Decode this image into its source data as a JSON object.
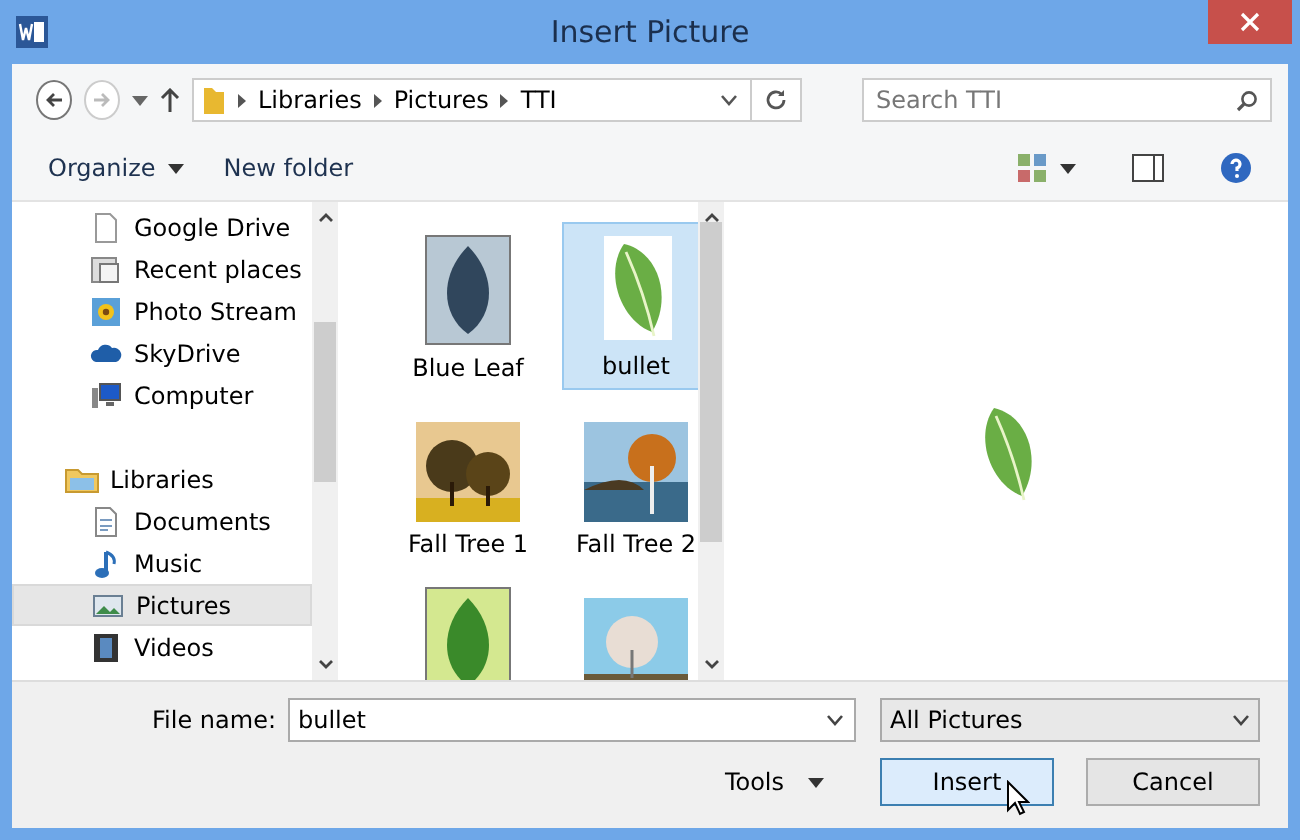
{
  "window": {
    "title": "Insert Picture"
  },
  "address": {
    "path": [
      "Libraries",
      "Pictures",
      "TTI"
    ],
    "search_placeholder": "Search TTI"
  },
  "toolbar": {
    "organize": "Organize",
    "new_folder": "New folder"
  },
  "sidebar": {
    "items": [
      {
        "label": "Google Drive",
        "kind": "file",
        "selected": false
      },
      {
        "label": "Recent places",
        "kind": "recent",
        "selected": false
      },
      {
        "label": "Photo Stream",
        "kind": "photo",
        "selected": false
      },
      {
        "label": "SkyDrive",
        "kind": "cloud",
        "selected": false
      },
      {
        "label": "Computer",
        "kind": "computer",
        "selected": false
      },
      {
        "label": "Libraries",
        "kind": "library",
        "selected": false,
        "children": [
          {
            "label": "Documents",
            "kind": "doc",
            "selected": false
          },
          {
            "label": "Music",
            "kind": "music",
            "selected": false
          },
          {
            "label": "Pictures",
            "kind": "pictures",
            "selected": true
          },
          {
            "label": "Videos",
            "kind": "video",
            "selected": false
          }
        ]
      }
    ]
  },
  "files": [
    {
      "label": "Blue Leaf",
      "kind": "leaf-blue",
      "selected": false
    },
    {
      "label": "bullet",
      "kind": "leaf-plain",
      "selected": true
    },
    {
      "label": "Fall Tree 1",
      "kind": "tree-field",
      "selected": false
    },
    {
      "label": "Fall Tree 2",
      "kind": "tree-lake",
      "selected": false
    },
    {
      "kind": "leaf-green",
      "selected": false
    },
    {
      "kind": "tree-spring",
      "selected": false
    }
  ],
  "footer": {
    "file_name_label": "File name:",
    "file_name": "bullet",
    "file_type": "All Pictures",
    "tools": "Tools",
    "insert": "Insert",
    "cancel": "Cancel"
  }
}
